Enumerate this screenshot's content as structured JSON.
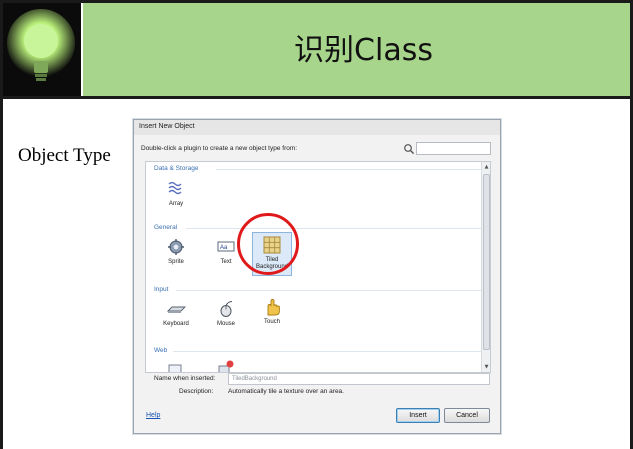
{
  "slide": {
    "title": "识别Class",
    "left_label": "Object Type"
  },
  "dialog": {
    "title": "Insert New Object",
    "instruction": "Double-click a plugin to create a new object type from:",
    "search": {
      "value": "",
      "placeholder": ""
    },
    "groups": [
      {
        "label": "Data & Storage",
        "items": [
          {
            "label": "Array",
            "icon": "array-icon"
          }
        ]
      },
      {
        "label": "General",
        "items": [
          {
            "label": "Sprite",
            "icon": "sprite-icon"
          },
          {
            "label": "Text",
            "icon": "text-icon"
          },
          {
            "label": "Tiled Background",
            "icon": "tiled-background-icon",
            "selected": true
          }
        ]
      },
      {
        "label": "Input",
        "items": [
          {
            "label": "Keyboard",
            "icon": "keyboard-icon"
          },
          {
            "label": "Mouse",
            "icon": "mouse-icon"
          },
          {
            "label": "Touch",
            "icon": "touch-icon"
          }
        ]
      },
      {
        "label": "Web",
        "items": []
      }
    ],
    "name_label": "Name when inserted:",
    "name_value": "TiledBackground",
    "description_label": "Description:",
    "description_value": "Automatically tile a texture over an area.",
    "help_label": "Help",
    "insert_label": "Insert",
    "cancel_label": "Cancel"
  },
  "colors": {
    "header_green": "#a7d58b",
    "highlight_red": "#e01a1a",
    "group_blue": "#3a6fb0"
  }
}
